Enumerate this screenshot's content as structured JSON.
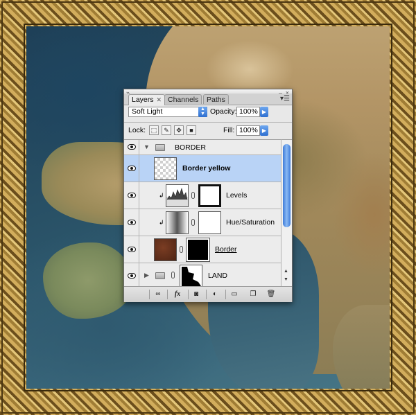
{
  "panel": {
    "tabs": [
      {
        "label": "Layers",
        "active": true
      },
      {
        "label": "Channels",
        "active": false
      },
      {
        "label": "Paths",
        "active": false
      }
    ],
    "blend_mode": "Soft Light",
    "opacity_label": "Opacity:",
    "opacity_value": "100%",
    "lock_label": "Lock:",
    "fill_label": "Fill:",
    "fill_value": "100%",
    "layers": [
      {
        "name": "BORDER",
        "kind": "group",
        "expanded": true
      },
      {
        "name": "Border yellow",
        "kind": "layer",
        "selected": true
      },
      {
        "name": "Levels",
        "kind": "adjustment"
      },
      {
        "name": "Hue/Saturation",
        "kind": "adjustment"
      },
      {
        "name": "Border",
        "kind": "layer-with-mask",
        "underlined": true
      },
      {
        "name": "LAND",
        "kind": "group",
        "expanded": false
      }
    ],
    "footer_icons": [
      "link-layers-icon",
      "fx-icon",
      "layer-mask-icon",
      "adjustment-layer-icon",
      "new-group-icon",
      "new-layer-icon",
      "trash-icon"
    ],
    "footer_labels": {
      "fx": "fx"
    }
  },
  "colors": {
    "selection": "#b9d3f6",
    "accent_blue": "#3d7bd8",
    "frame_gold": "#a07d35"
  }
}
